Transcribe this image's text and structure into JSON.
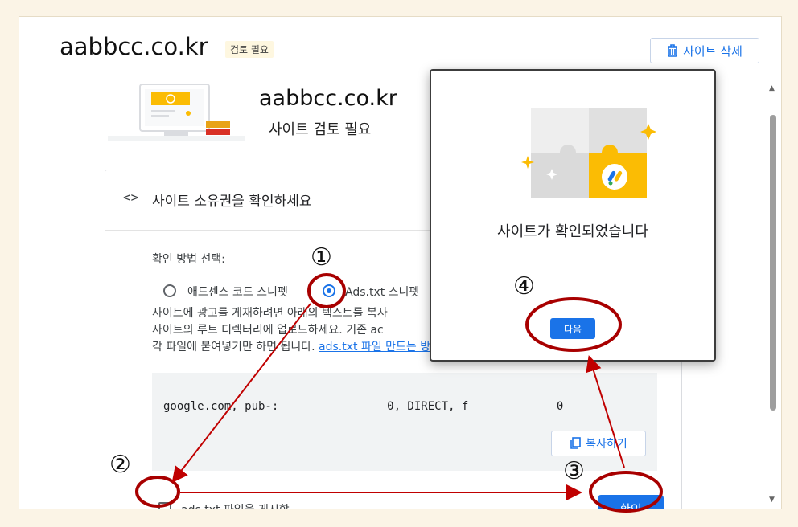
{
  "header": {
    "domain": "aabbcc.co.kr",
    "badge": "검토 필요",
    "delete_label": "사이트 삭제"
  },
  "hero": {
    "domain": "aabbcc.co.kr",
    "status": "사이트 검토 필요"
  },
  "card": {
    "title": "사이트 소유권을 확인하세요",
    "method_label": "확인 방법 선택:",
    "options": [
      {
        "label": "애드센스 코드 스니펫",
        "selected": false
      },
      {
        "label": "Ads.txt 스니펫",
        "selected": true
      }
    ],
    "description_lines": [
      "사이트에 광고를 게재하려면 아래의 텍스트를 복사",
      "사이트의 루트 디렉터리에 업로드하세요. 기존 ac",
      "각 파일에 붙여넣기만 하면 됩니다. "
    ],
    "description_link": "ads.txt 파일 만드는 방법에 대해 자세히 알아보기",
    "code_text": "google.com, pub-:                0, DIRECT, f             0",
    "copy_label": "복사하기",
    "checkbox_label": "ads.txt 파일을 게시함",
    "confirm_label": "확인"
  },
  "modal": {
    "message": "사이트가 확인되었습니다",
    "next_label": "다음"
  },
  "annotations": {
    "step1": "①",
    "step2": "②",
    "step3": "③",
    "step4": "④"
  },
  "colors": {
    "accent": "#1a73e8",
    "annotation": "#c00000",
    "highlight_yellow": "#fbbc04"
  }
}
